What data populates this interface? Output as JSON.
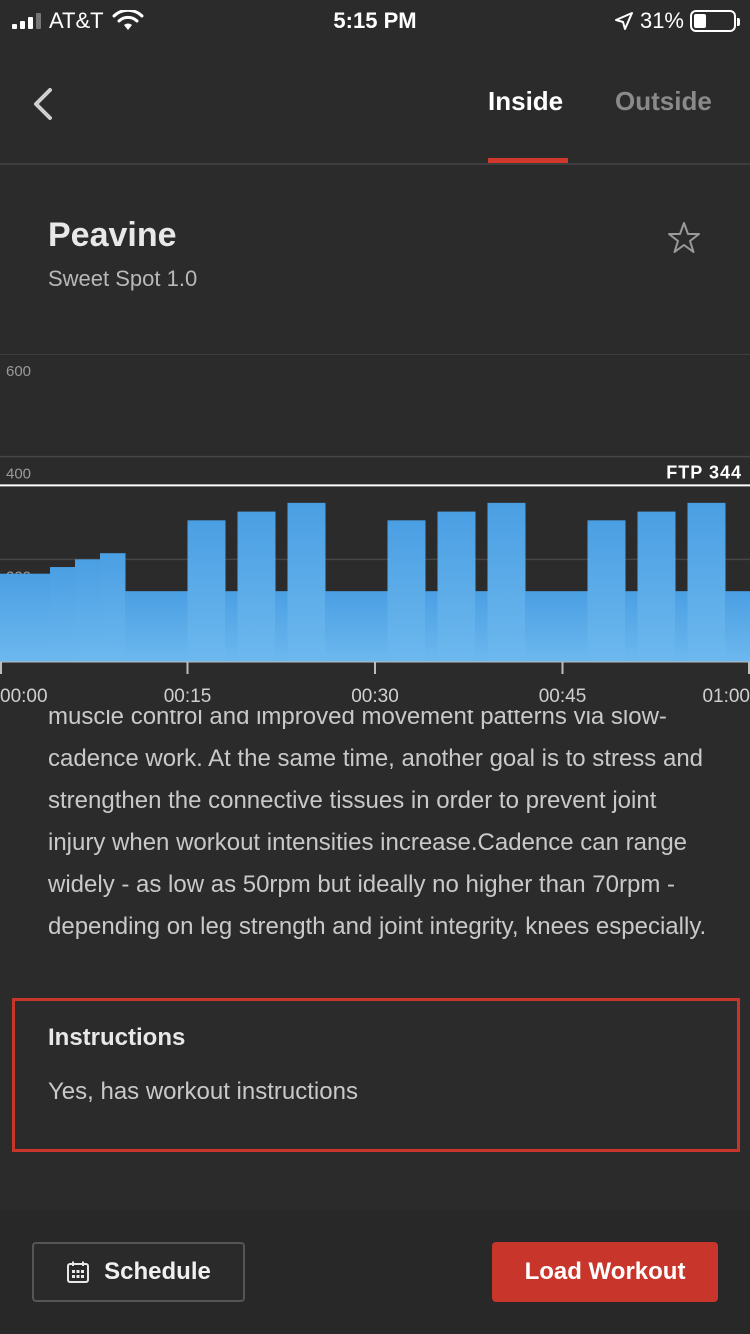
{
  "status_bar": {
    "carrier": "AT&T",
    "time": "5:15 PM",
    "battery_percent": "31%",
    "battery_level": 0.31
  },
  "nav": {
    "tabs": [
      {
        "label": "Inside",
        "active": true
      },
      {
        "label": "Outside",
        "active": false
      }
    ]
  },
  "workout": {
    "title": "Peavine",
    "subtitle": "Sweet Spot 1.0"
  },
  "chart_data": {
    "type": "bar",
    "ftp_label": "FTP 344",
    "ftp_value": 344,
    "y_ticks": [
      "600",
      "400",
      "200"
    ],
    "ylim": [
      0,
      600
    ],
    "x_ticks": [
      "00:00",
      "00:15",
      "00:30",
      "00:45",
      "01:00"
    ],
    "xlim": [
      0,
      60
    ],
    "segments": [
      {
        "start": 0.0,
        "end": 4.0,
        "value": 172
      },
      {
        "start": 4.0,
        "end": 6.0,
        "value": 185
      },
      {
        "start": 6.0,
        "end": 8.0,
        "value": 200
      },
      {
        "start": 8.0,
        "end": 10.0,
        "value": 212
      },
      {
        "start": 10.0,
        "end": 15.0,
        "value": 138
      },
      {
        "start": 15.0,
        "end": 18.0,
        "value": 276
      },
      {
        "start": 18.0,
        "end": 19.0,
        "value": 138
      },
      {
        "start": 19.0,
        "end": 22.0,
        "value": 293
      },
      {
        "start": 22.0,
        "end": 23.0,
        "value": 138
      },
      {
        "start": 23.0,
        "end": 26.0,
        "value": 310
      },
      {
        "start": 26.0,
        "end": 31.0,
        "value": 138
      },
      {
        "start": 31.0,
        "end": 34.0,
        "value": 276
      },
      {
        "start": 34.0,
        "end": 35.0,
        "value": 138
      },
      {
        "start": 35.0,
        "end": 38.0,
        "value": 293
      },
      {
        "start": 38.0,
        "end": 39.0,
        "value": 138
      },
      {
        "start": 39.0,
        "end": 42.0,
        "value": 310
      },
      {
        "start": 42.0,
        "end": 47.0,
        "value": 138
      },
      {
        "start": 47.0,
        "end": 50.0,
        "value": 276
      },
      {
        "start": 50.0,
        "end": 51.0,
        "value": 138
      },
      {
        "start": 51.0,
        "end": 54.0,
        "value": 293
      },
      {
        "start": 54.0,
        "end": 55.0,
        "value": 138
      },
      {
        "start": 55.0,
        "end": 58.0,
        "value": 310
      },
      {
        "start": 58.0,
        "end": 60.0,
        "value": 138
      }
    ],
    "bar_color": "#4a9fe3"
  },
  "description": {
    "text": "muscle control and improved movement patterns via slow-cadence work. At the same time, another goal is to stress and strengthen the connective tissues in order to prevent joint injury when workout intensities increase.Cadence can range widely - as low as 50rpm but ideally no higher than 70rpm - depending on leg strength and joint integrity, knees especially."
  },
  "instructions": {
    "heading": "Instructions",
    "text": "Yes, has workout instructions"
  },
  "footer": {
    "schedule_label": "Schedule",
    "load_label": "Load Workout"
  },
  "colors": {
    "accent": "#c8352a",
    "background": "#2b2b2b",
    "bar": "#4a9fe3"
  }
}
